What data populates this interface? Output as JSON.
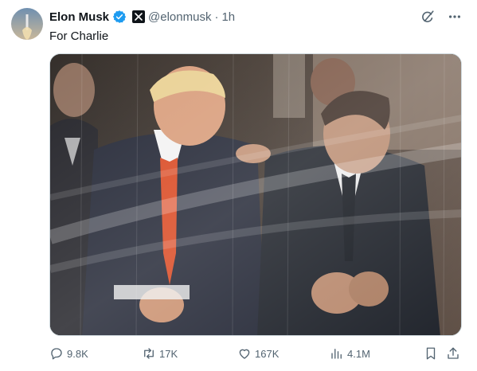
{
  "post": {
    "display_name": "Elon Musk",
    "handle": "@elonmusk",
    "separator": "·",
    "time": "1h",
    "text": "For Charlie"
  },
  "icons": {
    "verified": "verified-badge-icon",
    "affiliate": "x-logo-icon",
    "grok": "grok-icon",
    "more": "more-options-icon",
    "reply": "reply-icon",
    "retweet": "retweet-icon",
    "like": "heart-icon",
    "views": "views-chart-icon",
    "bookmark": "bookmark-icon",
    "share": "share-icon"
  },
  "metrics": {
    "replies": "9.8K",
    "reposts": "17K",
    "likes": "167K",
    "views": "4.1M"
  },
  "colors": {
    "verified_blue": "#1d9bf0",
    "text_primary": "#0f1419",
    "text_secondary": "#536471",
    "tie_orange": "#d9441c"
  }
}
